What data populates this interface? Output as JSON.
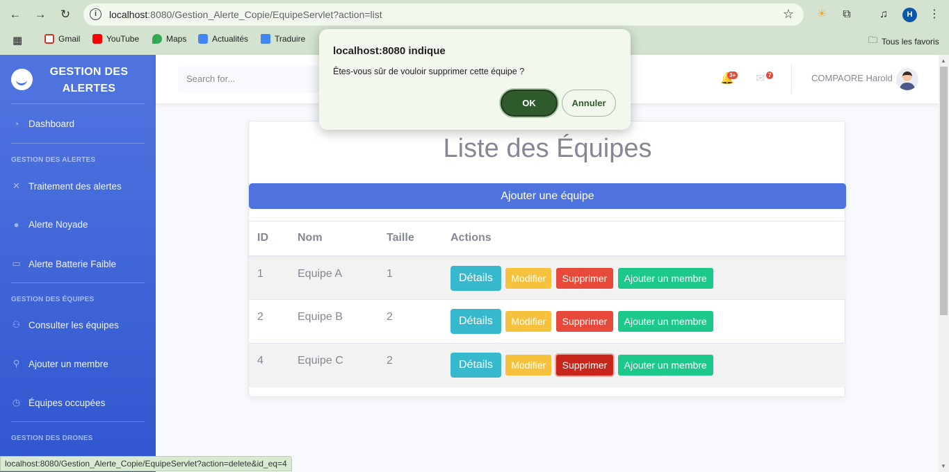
{
  "browser": {
    "url_host": "localhost",
    "url_rest": ":8080/Gestion_Alerte_Copie/EquipeServlet?action=list",
    "profile_initial": "H",
    "bookmarks": [
      "Gmail",
      "YouTube",
      "Maps",
      "Actualités",
      "Traduire"
    ],
    "all_bookmarks": "Tous les favoris",
    "status_url": "localhost:8080/Gestion_Alerte_Copie/EquipeServlet?action=delete&id_eq=4"
  },
  "sidebar": {
    "brand": "GESTION DES ALERTES",
    "dashboard": "Dashboard",
    "sections": [
      {
        "heading": "GESTION DES ALERTES",
        "items": [
          "Traitement des alertes",
          "Alerte Noyade",
          "Alerte Batterie Faible"
        ]
      },
      {
        "heading": "GESTION DES ÉQUIPES",
        "items": [
          "Consulter les équipes",
          "Ajouter un membre",
          "Équipes occupées"
        ]
      },
      {
        "heading": "GESTION DES DRONES",
        "items": []
      }
    ]
  },
  "topbar": {
    "search_placeholder": "Search for...",
    "alerts_badge": "3+",
    "messages_badge": "7",
    "user_name": "COMPAORE Harold"
  },
  "main": {
    "title": "Liste des Équipes",
    "add_button": "Ajouter une équipe",
    "columns": [
      "ID",
      "Nom",
      "Taille",
      "Actions"
    ],
    "rows": [
      {
        "id": "1",
        "nom": "Equipe A",
        "taille": "1"
      },
      {
        "id": "2",
        "nom": "Equipe B",
        "taille": "2"
      },
      {
        "id": "4",
        "nom": "Equipe C",
        "taille": "2"
      }
    ],
    "actions": {
      "details": "Détails",
      "modifier": "Modifier",
      "supprimer": "Supprimer",
      "ajouter_membre": "Ajouter un membre"
    }
  },
  "dialog": {
    "title": "localhost:8080 indique",
    "message": "Êtes-vous sûr de vouloir supprimer cette équipe ?",
    "ok": "OK",
    "cancel": "Annuler"
  },
  "colors": {
    "primary": "#4e73df",
    "info": "#36b9cc",
    "warning": "#f6c23e",
    "danger": "#e74a3b",
    "success": "#1cc88a"
  }
}
